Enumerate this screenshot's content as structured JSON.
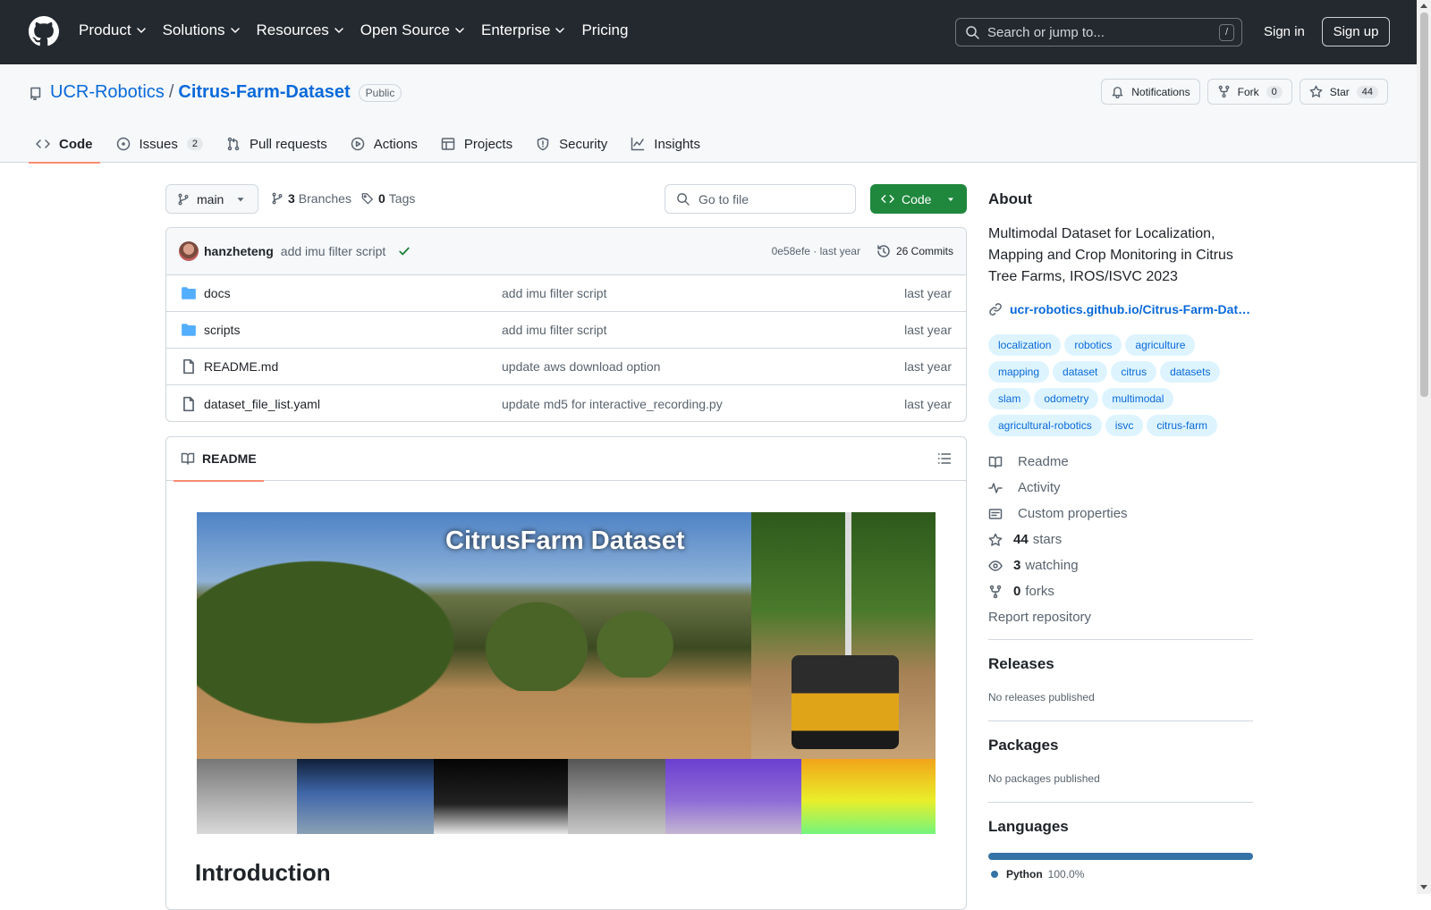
{
  "header": {
    "nav": [
      "Product",
      "Solutions",
      "Resources",
      "Open Source",
      "Enterprise",
      "Pricing"
    ],
    "search_placeholder": "Search or jump to...",
    "search_key": "/",
    "sign_in": "Sign in",
    "sign_up": "Sign up"
  },
  "repo": {
    "owner": "UCR-Robotics",
    "separator": "/",
    "name": "Citrus-Farm-Dataset",
    "visibility": "Public",
    "notifications": "Notifications",
    "fork_label": "Fork",
    "fork_count": "0",
    "star_label": "Star",
    "star_count": "44"
  },
  "tabs": [
    {
      "label": "Code",
      "icon": "code-icon"
    },
    {
      "label": "Issues",
      "icon": "issue-icon",
      "count": "2"
    },
    {
      "label": "Pull requests",
      "icon": "pull-request-icon"
    },
    {
      "label": "Actions",
      "icon": "play-icon"
    },
    {
      "label": "Projects",
      "icon": "table-icon"
    },
    {
      "label": "Security",
      "icon": "shield-icon"
    },
    {
      "label": "Insights",
      "icon": "graph-icon"
    }
  ],
  "toolbar": {
    "branch": "main",
    "branches_count": "3",
    "branches_label": "Branches",
    "tags_count": "0",
    "tags_label": "Tags",
    "goto_file": "Go to file",
    "code_button": "Code"
  },
  "commit": {
    "user": "hanzheteng",
    "message": "add imu filter script",
    "sha_time": "0e58efe · last year",
    "commits": "26 Commits"
  },
  "files": [
    {
      "name": "docs",
      "type": "folder",
      "message": "add imu filter script",
      "time": "last year"
    },
    {
      "name": "scripts",
      "type": "folder",
      "message": "add imu filter script",
      "time": "last year"
    },
    {
      "name": "README.md",
      "type": "file",
      "message": "update aws download option",
      "time": "last year"
    },
    {
      "name": "dataset_file_list.yaml",
      "type": "file",
      "message": "update md5 for interactive_recording.py",
      "time": "last year"
    }
  ],
  "readme": {
    "tab": "README",
    "banner_title": "CitrusFarm Dataset",
    "heading": "Introduction"
  },
  "about": {
    "heading": "About",
    "description": "Multimodal Dataset for Localization, Mapping and Crop Monitoring in Citrus Tree Farms, IROS/ISVC 2023",
    "link": "ucr-robotics.github.io/Citrus-Farm-Dat…",
    "topics": [
      "localization",
      "robotics",
      "agriculture",
      "mapping",
      "dataset",
      "citrus",
      "datasets",
      "slam",
      "odometry",
      "multimodal",
      "agricultural-robotics",
      "isvc",
      "citrus-farm"
    ],
    "items": [
      {
        "icon": "book-icon",
        "bold": "",
        "text": "Readme"
      },
      {
        "icon": "pulse-icon",
        "bold": "",
        "text": "Activity"
      },
      {
        "icon": "note-icon",
        "bold": "",
        "text": "Custom properties"
      },
      {
        "icon": "star-icon",
        "bold": "44",
        "text": "stars"
      },
      {
        "icon": "eye-icon",
        "bold": "3",
        "text": "watching"
      },
      {
        "icon": "fork-icon",
        "bold": "0",
        "text": "forks"
      }
    ],
    "report": "Report repository"
  },
  "releases": {
    "heading": "Releases",
    "text": "No releases published"
  },
  "packages": {
    "heading": "Packages",
    "text": "No packages published"
  },
  "languages": {
    "heading": "Languages",
    "name": "Python",
    "percent": "100.0%",
    "color": "#3572a5",
    "fraction": 1.0
  }
}
